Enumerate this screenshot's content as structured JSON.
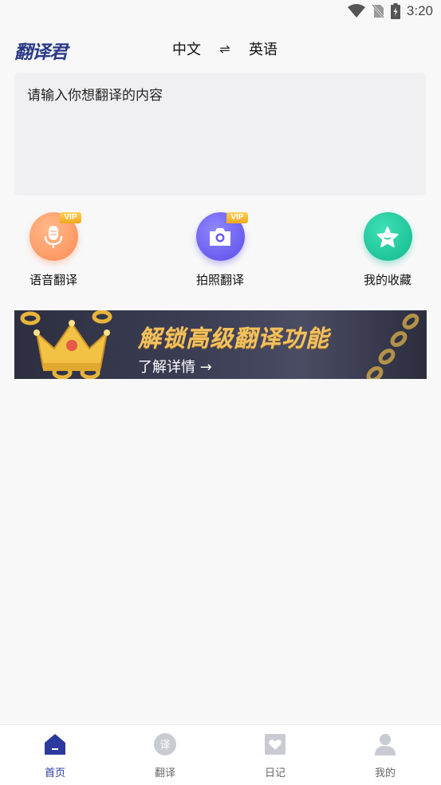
{
  "status_bar": {
    "time": "3:20"
  },
  "header": {
    "app_name": "翻译君",
    "source_lang": "中文",
    "swap_symbol": "⇌",
    "target_lang": "英语"
  },
  "input": {
    "placeholder": "请输入你想翻译的内容"
  },
  "features": [
    {
      "label": "语音翻译",
      "badge": "VIP",
      "color": "#ff9a66"
    },
    {
      "label": "拍照翻译",
      "badge": "VIP",
      "color": "#6a5cf0"
    },
    {
      "label": "我的收藏",
      "badge": "",
      "color": "#1fc79f"
    }
  ],
  "banner": {
    "title": "解锁高级翻译功能",
    "subtitle": "了解详情 →"
  },
  "bottom_nav": [
    {
      "label": "首页",
      "icon": "home-icon",
      "active": true
    },
    {
      "label": "翻译",
      "icon": "translate-icon",
      "active": false
    },
    {
      "label": "日记",
      "icon": "diary-icon",
      "active": false
    },
    {
      "label": "我的",
      "icon": "profile-icon",
      "active": false
    }
  ],
  "colors": {
    "accent": "#2b3a9c",
    "background": "#f8f8f9"
  }
}
